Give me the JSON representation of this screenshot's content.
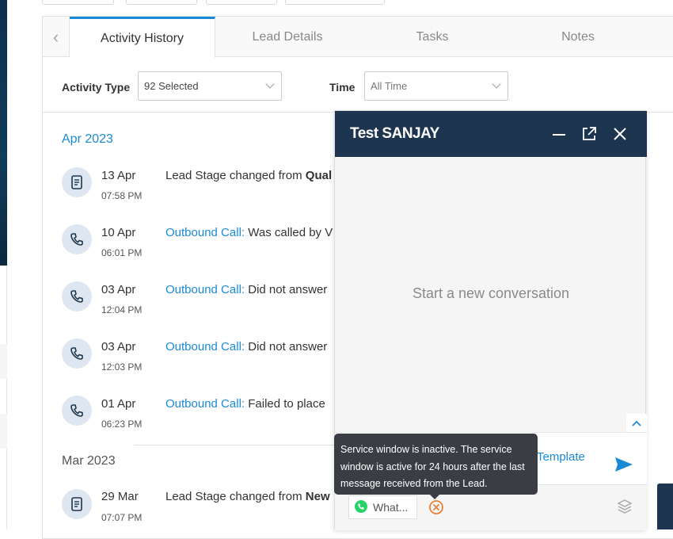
{
  "tabs": {
    "items": [
      {
        "label": "Activity History",
        "active": true
      },
      {
        "label": "Lead Details",
        "active": false
      },
      {
        "label": "Tasks",
        "active": false
      },
      {
        "label": "Notes",
        "active": false
      }
    ]
  },
  "filters": {
    "activity_type_label": "Activity Type",
    "activity_type_value": "92 Selected",
    "time_label": "Time",
    "time_value": "All Time"
  },
  "timeline": {
    "months": [
      "Apr 2023",
      "Mar 2023"
    ],
    "activities": [
      {
        "icon": "document-icon",
        "date": "13 Apr",
        "time": "07:58 PM",
        "prefix": "",
        "text": "Lead Stage changed from ",
        "bold": "Qual"
      },
      {
        "icon": "phone-icon",
        "date": "10 Apr",
        "time": "06:01 PM",
        "prefix": "Outbound Call:",
        "text": " Was called by V",
        "bold": ""
      },
      {
        "icon": "phone-icon",
        "date": "03 Apr",
        "time": "12:04 PM",
        "prefix": "Outbound Call:",
        "text": " Did not answer",
        "bold": ""
      },
      {
        "icon": "phone-icon",
        "date": "03 Apr",
        "time": "12:03 PM",
        "prefix": "Outbound Call:",
        "text": " Did not answer",
        "bold": ""
      },
      {
        "icon": "phone-icon",
        "date": "01 Apr",
        "time": "06:23 PM",
        "prefix": "Outbound Call:",
        "text": " Failed to place",
        "bold": ""
      },
      {
        "icon": "document-icon",
        "date": "29 Mar",
        "time": "07:07 PM",
        "prefix": "",
        "text": "Lead Stage changed from ",
        "bold": "New"
      }
    ]
  },
  "chat": {
    "title": "Test SANJAY",
    "empty_text": "Start a new conversation",
    "template_link": "Template",
    "channel_label": "What...",
    "tooltip": "Service window is inactive. The service window is active for 24 hours after the last message received from the Lead."
  },
  "colors": {
    "accent": "#1a8ad6",
    "chat_header": "#1e3550",
    "warning": "#e8813a",
    "whatsapp": "#25d366"
  }
}
